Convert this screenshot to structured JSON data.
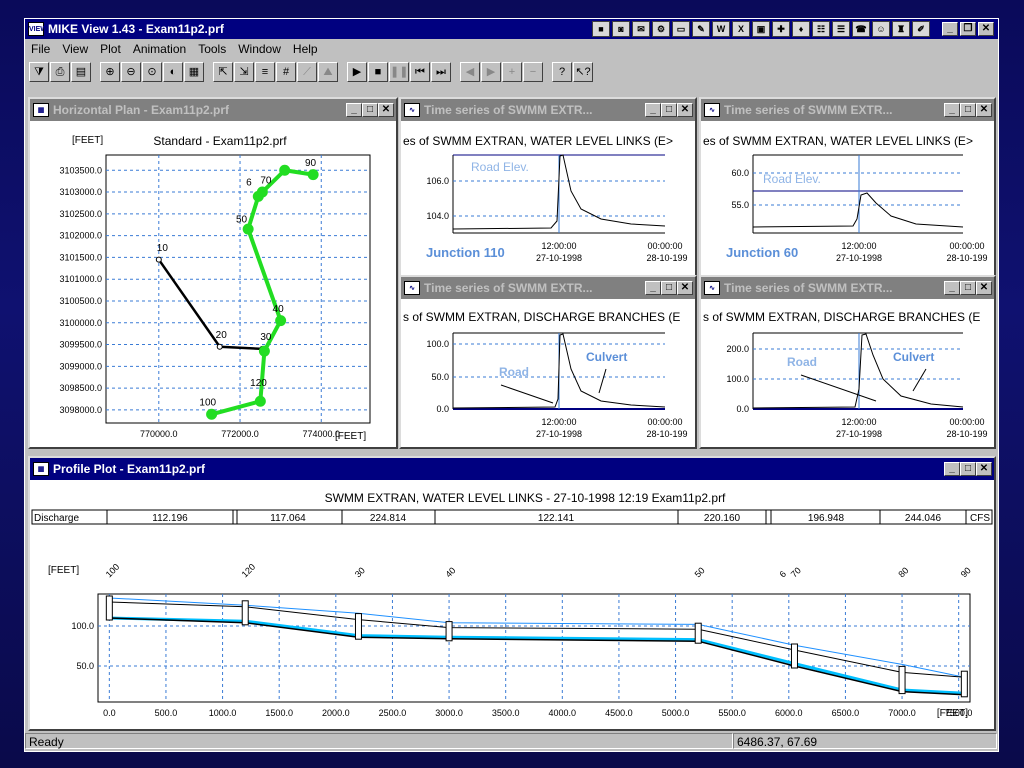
{
  "app": {
    "title": "MIKE View 1.43 - Exam11p2.prf",
    "icon_text": "VIEW"
  },
  "menu": [
    "File",
    "View",
    "Plot",
    "Animation",
    "Tools",
    "Window",
    "Help"
  ],
  "toolbar_icons": [
    "filter-icon",
    "print-icon",
    "open-icon",
    "zoom-in-icon",
    "zoom-out-icon",
    "zoom-window-icon",
    "zoom-reset-icon",
    "properties-icon",
    "select-icon",
    "select2-icon",
    "tool5-icon",
    "grid-icon",
    "disabled-icon",
    "disabled2-icon",
    "play-icon",
    "stop-icon",
    "pause-icon",
    "rewind-icon",
    "fastforward-icon",
    "step-back-icon",
    "step-forward-icon",
    "plus-icon",
    "minus-icon",
    "help-icon",
    "context-help-icon"
  ],
  "windows": {
    "plan": {
      "title": "Horizontal Plan - Exam11p2.prf",
      "chart_title": "Standard - Exam11p2.prf",
      "y_unit": "[FEET]",
      "x_unit": "[FEET]"
    },
    "ts1": {
      "title": "Time series of SWMM EXTR...",
      "heading": "es of SWMM EXTRAN, WATER LEVEL LINKS (E>",
      "label": "Junction 110",
      "annot": "Road Elev.",
      "t1": "12:00:00",
      "d1": "27-10-1998",
      "t2": "00:00:00",
      "d2": "28-10-199"
    },
    "ts2": {
      "title": "Time series of SWMM EXTR...",
      "heading": "es of SWMM EXTRAN, WATER LEVEL LINKS (E>",
      "label": "Junction 60",
      "annot": "Road Elev.",
      "t1": "12:00:00",
      "d1": "27-10-1998",
      "t2": "00:00:00",
      "d2": "28-10-199"
    },
    "ts3": {
      "title": "Time series of SWMM EXTR...",
      "heading": "s of SWMM EXTRAN, DISCHARGE BRANCHES (E",
      "annot1": "Road",
      "annot2": "Culvert",
      "t1": "12:00:00",
      "d1": "27-10-1998",
      "t2": "00:00:00",
      "d2": "28-10-199"
    },
    "ts4": {
      "title": "Time series of SWMM EXTR...",
      "heading": "s of SWMM EXTRAN, DISCHARGE BRANCHES (E",
      "annot1": "Road",
      "annot2": "Culvert",
      "t1": "12:00:00",
      "d1": "27-10-1998",
      "t2": "00:00:00",
      "d2": "28-10-199"
    },
    "profile": {
      "title": "Profile Plot - Exam11p2.prf",
      "heading": "SWMM EXTRAN, WATER LEVEL LINKS - 27-10-1998 12:19 Exam11p2.prf",
      "discharge_label": "Discharge",
      "discharge_values": [
        "112.196",
        "117.064",
        "224.814",
        "122.141",
        "220.160",
        "196.948",
        "244.046"
      ],
      "discharge_unit": "CFS",
      "y_unit": "[FEET]",
      "x_unit": "[FEET]"
    }
  },
  "status": {
    "text": "Ready",
    "coords": "6486.37, 67.69"
  },
  "chart_data": [
    {
      "type": "line",
      "title": "Standard - Exam11p2.prf",
      "xlabel": "[FEET]",
      "ylabel": "[FEET]",
      "xlim": [
        768700,
        775200
      ],
      "ylim": [
        3097700,
        3103850
      ],
      "x_ticks": [
        770000,
        772000,
        774000
      ],
      "y_ticks": [
        3098000,
        3098500,
        3099000,
        3099500,
        3100000,
        3100500,
        3101000,
        3101500,
        3102000,
        3102500,
        3103000,
        3103500
      ],
      "x_tick_labels": [
        "770000.0",
        "772000.0",
        "774000.0"
      ],
      "y_tick_labels": [
        "3098000.0",
        "3098500.0",
        "3099000.0",
        "3099500.0",
        "3100000.0",
        "3100500.0",
        "3101000.0",
        "3101500.0",
        "3102000.0",
        "3102500.0",
        "3103000.0",
        "3103500.0"
      ],
      "series": [
        {
          "color": "#000000",
          "points": [
            [
              770000,
              3101450
            ],
            [
              771500,
              3099450
            ],
            [
              772550,
              3099400
            ]
          ]
        },
        {
          "color": "#22dd22",
          "points": [
            [
              771300,
              3097900
            ],
            [
              772500,
              3098200
            ],
            [
              772600,
              3099350
            ],
            [
              773000,
              3100050
            ],
            [
              772200,
              3102150
            ],
            [
              772450,
              3102900
            ],
            [
              772550,
              3103000
            ],
            [
              773100,
              3103500
            ],
            [
              773800,
              3103400
            ]
          ]
        }
      ],
      "node_labels": [
        {
          "text": "10",
          "x": 769950,
          "y": 3101650
        },
        {
          "text": "20",
          "x": 771400,
          "y": 3099650
        },
        {
          "text": "30",
          "x": 772500,
          "y": 3099600
        },
        {
          "text": "40",
          "x": 772800,
          "y": 3100250
        },
        {
          "text": "50",
          "x": 771900,
          "y": 3102300
        },
        {
          "text": "70",
          "x": 772500,
          "y": 3103200
        },
        {
          "text": "6",
          "x": 772150,
          "y": 3103150
        },
        {
          "text": "90",
          "x": 773600,
          "y": 3103600
        },
        {
          "text": "100",
          "x": 771000,
          "y": 3098100
        },
        {
          "text": "120",
          "x": 772250,
          "y": 3098550
        }
      ]
    },
    {
      "type": "line",
      "title": "SWMM EXTRAN, WATER LEVEL LINKS - 27-10-1998 12:19 Exam11p2.prf",
      "xlabel": "[FEET]",
      "ylabel": "[FEET]",
      "xlim": [
        -100,
        7600
      ],
      "ylim": [
        5,
        140
      ],
      "x_ticks": [
        0,
        500,
        1000,
        1500,
        2000,
        2500,
        3000,
        3500,
        4000,
        4500,
        5000,
        5500,
        6000,
        6500,
        7000,
        7500
      ],
      "x_tick_labels": [
        "0.0",
        "500.0",
        "1000.0",
        "1500.0",
        "2000.0",
        "2500.0",
        "3000.0",
        "3500.0",
        "4000.0",
        "4500.0",
        "5000.0",
        "5500.0",
        "6000.0",
        "6500.0",
        "7000.0",
        "7500.0"
      ],
      "y_ticks": [
        50,
        100
      ],
      "y_tick_labels": [
        "50.0",
        "100.0"
      ],
      "node_labels": [
        {
          "text": "100",
          "x": 0
        },
        {
          "text": "120",
          "x": 1200
        },
        {
          "text": "30",
          "x": 2200
        },
        {
          "text": "40",
          "x": 3000
        },
        {
          "text": "50",
          "x": 5200
        },
        {
          "text": "6",
          "x": 5950
        },
        {
          "text": "70",
          "x": 6050
        },
        {
          "text": "80",
          "x": 7000
        },
        {
          "text": "90",
          "x": 7550
        }
      ],
      "series": [
        {
          "name": "top",
          "color": "#1e90ff",
          "x": [
            0,
            1200,
            2200,
            3000,
            5200,
            6050,
            7000,
            7550
          ],
          "values": [
            135,
            126,
            116,
            104,
            102,
            76,
            52,
            36
          ]
        },
        {
          "name": "crown",
          "color": "#000000",
          "x": [
            0,
            1200,
            2200,
            3000,
            5200,
            6050,
            7000,
            7550
          ],
          "values": [
            130,
            124,
            108,
            98,
            96,
            70,
            42,
            36
          ]
        },
        {
          "name": "water",
          "color": "#00bfff",
          "x": [
            0,
            1200,
            2200,
            3000,
            5200,
            6050,
            7000,
            7550
          ],
          "values": [
            110,
            106,
            88,
            86,
            83,
            53,
            20,
            16
          ]
        },
        {
          "name": "invert",
          "color": "#000000",
          "x": [
            0,
            1200,
            2200,
            3000,
            5200,
            6050,
            7000,
            7550
          ],
          "values": [
            110,
            104,
            86,
            84,
            81,
            50,
            18,
            14
          ]
        }
      ]
    }
  ]
}
